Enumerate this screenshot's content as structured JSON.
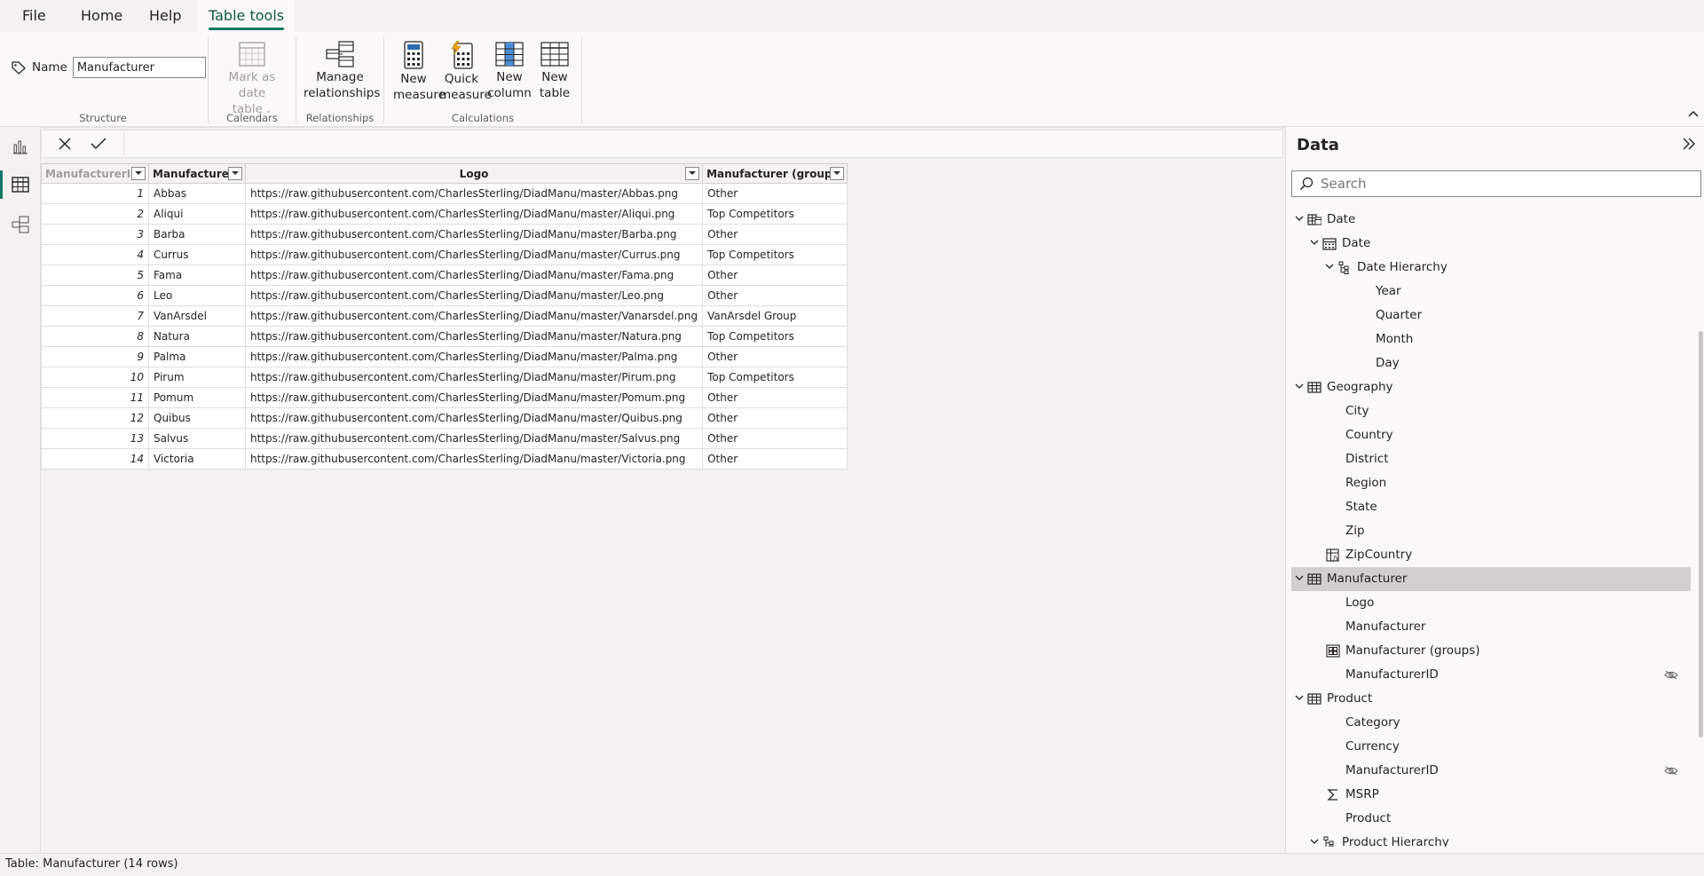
{
  "menu": {
    "tabs": [
      {
        "label": "File"
      },
      {
        "label": "Home"
      },
      {
        "label": "Help"
      },
      {
        "label": "Table tools"
      }
    ]
  },
  "ribbon": {
    "structure": {
      "name_label": "Name",
      "name_value": "Manufacturer",
      "group_label": "Structure"
    },
    "calendars": {
      "mark_line1": "Mark as date",
      "mark_line2": "table",
      "group_label": "Calendars"
    },
    "relationships": {
      "manage_line1": "Manage",
      "manage_line2": "relationships",
      "group_label": "Relationships"
    },
    "calculations": {
      "group_label": "Calculations",
      "new_measure": [
        "New",
        "measure"
      ],
      "quick_measure": [
        "Quick",
        "measure"
      ],
      "new_column": [
        "New",
        "column"
      ],
      "new_table": [
        "New",
        "table"
      ]
    }
  },
  "table": {
    "columns": [
      "ManufacturerID",
      "Manufacturer",
      "Logo",
      "Manufacturer (groups)"
    ],
    "rows": [
      [
        "1",
        "Abbas",
        "https://raw.githubusercontent.com/CharlesSterling/DiadManu/master/Abbas.png",
        "Other"
      ],
      [
        "2",
        "Aliqui",
        "https://raw.githubusercontent.com/CharlesSterling/DiadManu/master/Aliqui.png",
        "Top Competitors"
      ],
      [
        "3",
        "Barba",
        "https://raw.githubusercontent.com/CharlesSterling/DiadManu/master/Barba.png",
        "Other"
      ],
      [
        "4",
        "Currus",
        "https://raw.githubusercontent.com/CharlesSterling/DiadManu/master/Currus.png",
        "Top Competitors"
      ],
      [
        "5",
        "Fama",
        "https://raw.githubusercontent.com/CharlesSterling/DiadManu/master/Fama.png",
        "Other"
      ],
      [
        "6",
        "Leo",
        "https://raw.githubusercontent.com/CharlesSterling/DiadManu/master/Leo.png",
        "Other"
      ],
      [
        "7",
        "VanArsdel",
        "https://raw.githubusercontent.com/CharlesSterling/DiadManu/master/Vanarsdel.png",
        "VanArsdel Group"
      ],
      [
        "8",
        "Natura",
        "https://raw.githubusercontent.com/CharlesSterling/DiadManu/master/Natura.png",
        "Top Competitors"
      ],
      [
        "9",
        "Palma",
        "https://raw.githubusercontent.com/CharlesSterling/DiadManu/master/Palma.png",
        "Other"
      ],
      [
        "10",
        "Pirum",
        "https://raw.githubusercontent.com/CharlesSterling/DiadManu/master/Pirum.png",
        "Top Competitors"
      ],
      [
        "11",
        "Pomum",
        "https://raw.githubusercontent.com/CharlesSterling/DiadManu/master/Pomum.png",
        "Other"
      ],
      [
        "12",
        "Quibus",
        "https://raw.githubusercontent.com/CharlesSterling/DiadManu/master/Quibus.png",
        "Other"
      ],
      [
        "13",
        "Salvus",
        "https://raw.githubusercontent.com/CharlesSterling/DiadManu/master/Salvus.png",
        "Other"
      ],
      [
        "14",
        "Victoria",
        "https://raw.githubusercontent.com/CharlesSterling/DiadManu/master/Victoria.png",
        "Other"
      ]
    ]
  },
  "data_pane": {
    "title": "Data",
    "search_placeholder": "Search",
    "tree": [
      {
        "label": "Date",
        "level": 0,
        "icon": "table-calendar-icon",
        "chevron": "down"
      },
      {
        "label": "Date",
        "level": 1,
        "icon": "calendar-icon",
        "chevron": "down"
      },
      {
        "label": "Date Hierarchy",
        "level": 2,
        "icon": "hierarchy-icon",
        "chevron": "down"
      },
      {
        "label": "Year",
        "level": 3,
        "icon": "",
        "chevron": ""
      },
      {
        "label": "Quarter",
        "level": 3,
        "icon": "",
        "chevron": ""
      },
      {
        "label": "Month",
        "level": 3,
        "icon": "",
        "chevron": ""
      },
      {
        "label": "Day",
        "level": 3,
        "icon": "",
        "chevron": ""
      },
      {
        "label": "Geography",
        "level": 0,
        "icon": "table-icon",
        "chevron": "down"
      },
      {
        "label": "City",
        "level": 1,
        "icon": "",
        "chevron": ""
      },
      {
        "label": "Country",
        "level": 1,
        "icon": "",
        "chevron": ""
      },
      {
        "label": "District",
        "level": 1,
        "icon": "",
        "chevron": ""
      },
      {
        "label": "Region",
        "level": 1,
        "icon": "",
        "chevron": ""
      },
      {
        "label": "State",
        "level": 1,
        "icon": "",
        "chevron": ""
      },
      {
        "label": "Zip",
        "level": 1,
        "icon": "",
        "chevron": ""
      },
      {
        "label": "ZipCountry",
        "level": 1,
        "icon": "calculated-column-icon",
        "chevron": ""
      },
      {
        "label": "Manufacturer",
        "level": 0,
        "icon": "table-icon",
        "chevron": "down",
        "selected": true
      },
      {
        "label": "Logo",
        "level": 1,
        "icon": "",
        "chevron": ""
      },
      {
        "label": "Manufacturer",
        "level": 1,
        "icon": "",
        "chevron": ""
      },
      {
        "label": "Manufacturer (groups)",
        "level": 1,
        "icon": "group-icon",
        "chevron": ""
      },
      {
        "label": "ManufacturerID",
        "level": 1,
        "icon": "",
        "chevron": "",
        "hidden": true
      },
      {
        "label": "Product",
        "level": 0,
        "icon": "table-icon",
        "chevron": "down"
      },
      {
        "label": "Category",
        "level": 1,
        "icon": "",
        "chevron": ""
      },
      {
        "label": "Currency",
        "level": 1,
        "icon": "",
        "chevron": ""
      },
      {
        "label": "ManufacturerID",
        "level": 1,
        "icon": "",
        "chevron": "",
        "hidden": true
      },
      {
        "label": "MSRP",
        "level": 1,
        "icon": "sigma-icon",
        "chevron": ""
      },
      {
        "label": "Product",
        "level": 1,
        "icon": "",
        "chevron": ""
      },
      {
        "label": "Product Hierarchy",
        "level": 1,
        "icon": "hierarchy-icon",
        "chevron": "down"
      }
    ]
  },
  "status": {
    "text": "Table: Manufacturer (14 rows)"
  },
  "colors": {
    "accent": "#117865",
    "selected_row": "#d2d0ce"
  }
}
